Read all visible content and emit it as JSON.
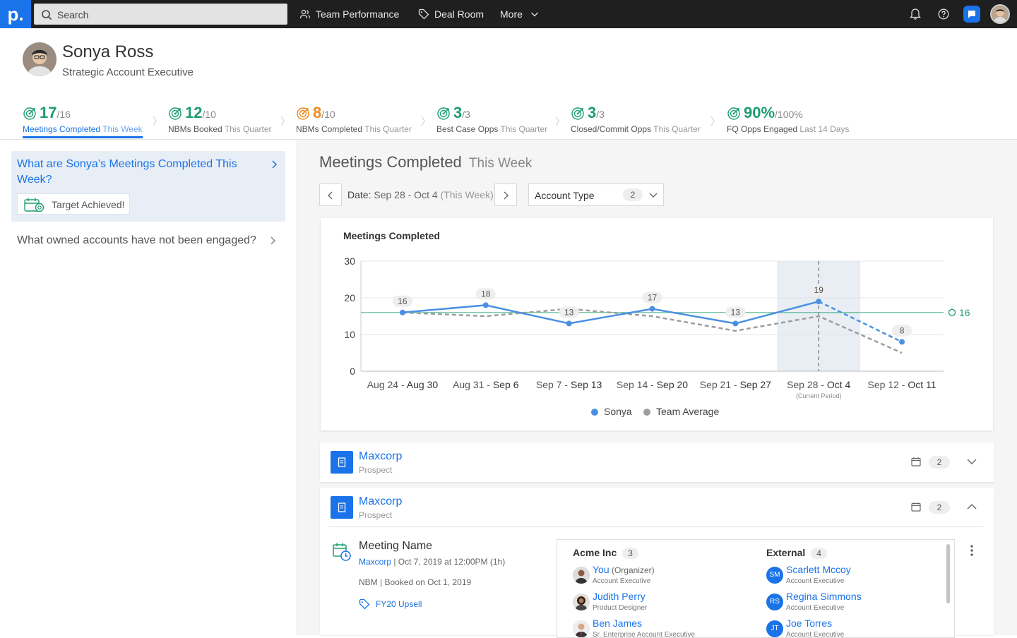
{
  "nav": {
    "search_placeholder": "Search",
    "items": [
      "Team Performance",
      "Deal Room",
      "More"
    ]
  },
  "profile": {
    "name": "Sonya Ross",
    "title": "Strategic Account Executive"
  },
  "metrics": [
    {
      "value": "17",
      "target": "/16",
      "label": "Meetings Completed",
      "period": "This Week",
      "color": "#1e9e6e"
    },
    {
      "value": "12",
      "target": "/10",
      "label": "NBMs Booked",
      "period": "This Quarter",
      "color": "#1e9e6e"
    },
    {
      "value": "8",
      "target": "/10",
      "label": "NBMs Completed",
      "period": "This Quarter",
      "color": "#f08a1c"
    },
    {
      "value": "3",
      "target": "/3",
      "label": "Best Case Opps",
      "period": "This Quarter",
      "color": "#1e9e6e"
    },
    {
      "value": "3",
      "target": "/3",
      "label": "Closed/Commit Opps",
      "period": "This Quarter",
      "color": "#1e9e6e"
    },
    {
      "value": "90%",
      "target": "/100%",
      "label": "FQ Opps Engaged",
      "period": "Last 14 Days",
      "color": "#1e9e6e"
    }
  ],
  "questions": {
    "active": "What are Sonya’s Meetings Completed This Week?",
    "badge": "Target Achieved!",
    "other": "What owned accounts have not been engaged?"
  },
  "section": {
    "title": "Meetings Completed",
    "period": "This Week",
    "date_label": "Date:",
    "date_value": "Sep 28 - Oct 4",
    "date_period": "(This Week)",
    "filter_label": "Account Type",
    "filter_count": "2"
  },
  "chart_data": {
    "type": "line",
    "title": "Meetings Completed",
    "categories": [
      {
        "start": "Aug 24",
        "end": "Aug 30"
      },
      {
        "start": "Aug 31",
        "end": "Sep 6"
      },
      {
        "start": "Sep 7",
        "end": "Sep 13"
      },
      {
        "start": "Sep 14",
        "end": "Sep 20"
      },
      {
        "start": "Sep 21",
        "end": "Sep 27"
      },
      {
        "start": "Sep 28",
        "end": "Oct 4"
      },
      {
        "start": "Sep 12",
        "end": "Oct 11"
      }
    ],
    "current_period_note": "(Current Period)",
    "ylim": [
      0,
      30
    ],
    "yticks": [
      0,
      10,
      20,
      30
    ],
    "series": [
      {
        "name": "Sonya",
        "color": "#4a90e2",
        "values": [
          16,
          18,
          13,
          17,
          13,
          19,
          8
        ]
      },
      {
        "name": "Team Average",
        "color": "#9e9e9e",
        "values": [
          16,
          15,
          17,
          15,
          11,
          15,
          5
        ]
      }
    ],
    "target": {
      "value": 16,
      "label": "16",
      "color": "#1e9e6e"
    },
    "legend": "bottom"
  },
  "accounts": [
    {
      "name": "Maxcorp",
      "type": "Prospect",
      "count": "2"
    },
    {
      "name": "Maxcorp",
      "type": "Prospect",
      "count": "2"
    }
  ],
  "meeting": {
    "name": "Meeting Name",
    "account": "Maxcorp",
    "when": " | Oct 7, 2019 at 12:00PM (1h)",
    "nbm": "NBM | Booked on Oct 1, 2019",
    "tag": "FY20 Upsell"
  },
  "attendees": {
    "internal_label": "Acme Inc",
    "internal_count": "3",
    "external_label": "External",
    "external_count": "4",
    "internal": [
      {
        "name": "You",
        "org": " (Organizer)",
        "role": "Account Executive"
      },
      {
        "name": "Judith Perry",
        "org": "",
        "role": "Product Designer"
      },
      {
        "name": "Ben James",
        "org": "",
        "role": "Sr. Enterprise Account Executive"
      }
    ],
    "external": [
      {
        "initials": "SM",
        "name": "Scarlett Mccoy",
        "role": "Account Executive"
      },
      {
        "initials": "RS",
        "name": "Regina Simmons",
        "role": "Account Executive"
      },
      {
        "initials": "JT",
        "name": "Joe Torres",
        "role": "Account Executive"
      }
    ]
  }
}
